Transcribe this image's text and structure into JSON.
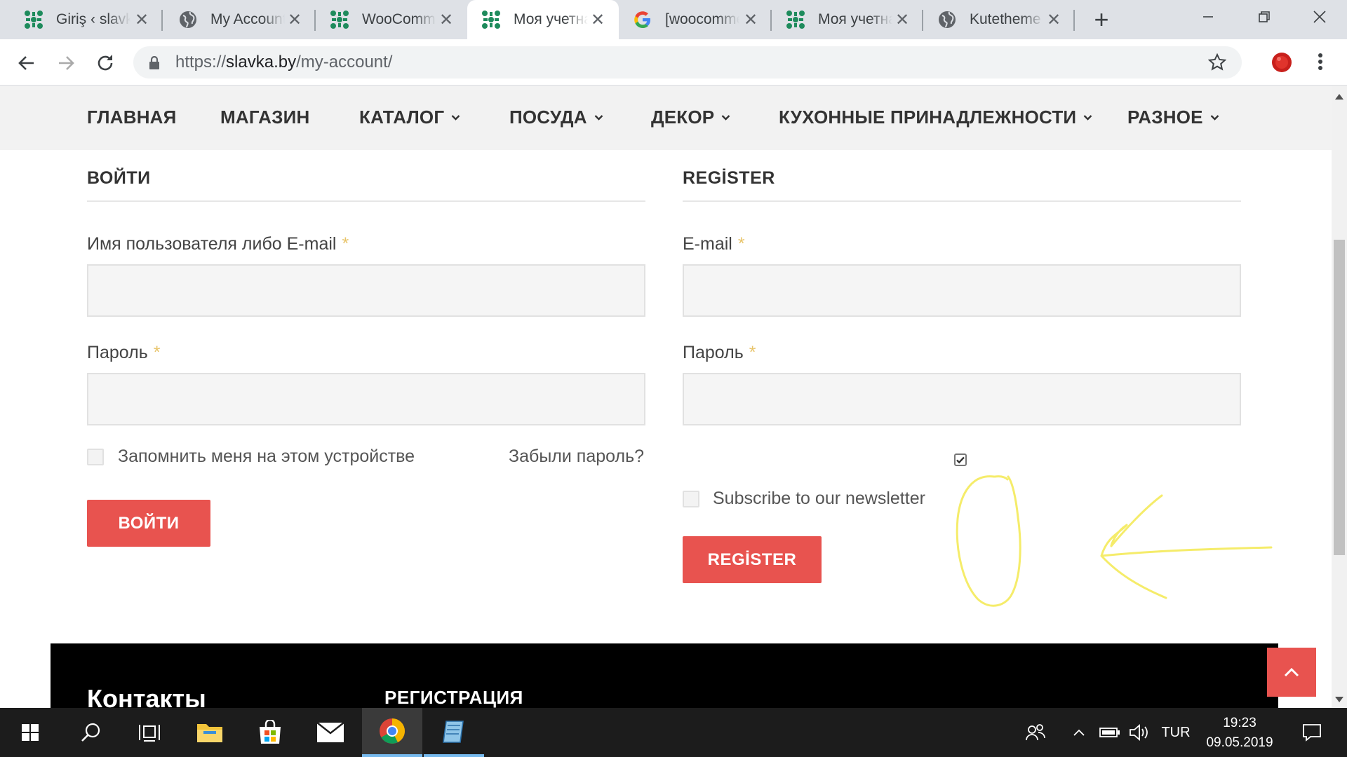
{
  "browser": {
    "tabs": [
      {
        "title": "Giriş ‹ slavka",
        "favicon": "slavka-logo-icon",
        "active": false
      },
      {
        "title": "My Account",
        "favicon": "globe-icon",
        "active": false
      },
      {
        "title": "WooCommerce",
        "favicon": "slavka-logo-icon",
        "active": false
      },
      {
        "title": "Моя учетная",
        "favicon": "slavka-logo-icon",
        "active": true
      },
      {
        "title": "[woocommerce",
        "favicon": "google-icon",
        "active": false
      },
      {
        "title": "Моя учетная",
        "favicon": "slavka-logo-icon",
        "active": false
      },
      {
        "title": "Kutetheme",
        "favicon": "globe-icon",
        "active": false
      }
    ],
    "url_scheme": "https://",
    "url_host": "slavka.by",
    "url_path": "/my-account/"
  },
  "mainnav": {
    "items": [
      {
        "label": "ГЛАВНАЯ",
        "has_dropdown": false
      },
      {
        "label": "МАГАЗИН",
        "has_dropdown": false
      },
      {
        "label": "КАТАЛОГ",
        "has_dropdown": true
      },
      {
        "label": "ПОСУДА",
        "has_dropdown": true
      },
      {
        "label": "ДЕКОР",
        "has_dropdown": true
      },
      {
        "label": "КУХОННЫЕ ПРИНАДЛЕЖНОСТИ",
        "has_dropdown": true
      },
      {
        "label": "РАЗНОЕ",
        "has_dropdown": true
      }
    ]
  },
  "login": {
    "title": "ВОЙТИ",
    "username_label": "Имя пользователя либо E-mail",
    "username_value": "",
    "password_label": "Пароль",
    "password_value": "",
    "remember_label": "Запомнить меня на этом устройстве",
    "remember_checked": false,
    "forgot_link": "Забыли пароль?",
    "submit_label": "ВОЙТИ"
  },
  "register": {
    "title": "REGİSTER",
    "email_label": "E-mail",
    "email_value": "",
    "password_label": "Пароль",
    "password_value": "",
    "extra_checkbox_checked": true,
    "newsletter_label": "Subscribe to our newsletter",
    "newsletter_checked": false,
    "submit_label": "REGİSTER"
  },
  "required_marker": "*",
  "footer": {
    "contacts_title": "Контакты",
    "registration_title": "РЕГИСТРАЦИЯ"
  },
  "taskbar": {
    "language": "TUR",
    "time": "19:23",
    "date": "09.05.2019"
  },
  "colors": {
    "accent_red": "#e8534f",
    "required_star": "#e8c46a",
    "annotation_yellow": "#f5ec6a",
    "nav_bg": "#f2f2f2",
    "footer_bg": "#000000"
  }
}
